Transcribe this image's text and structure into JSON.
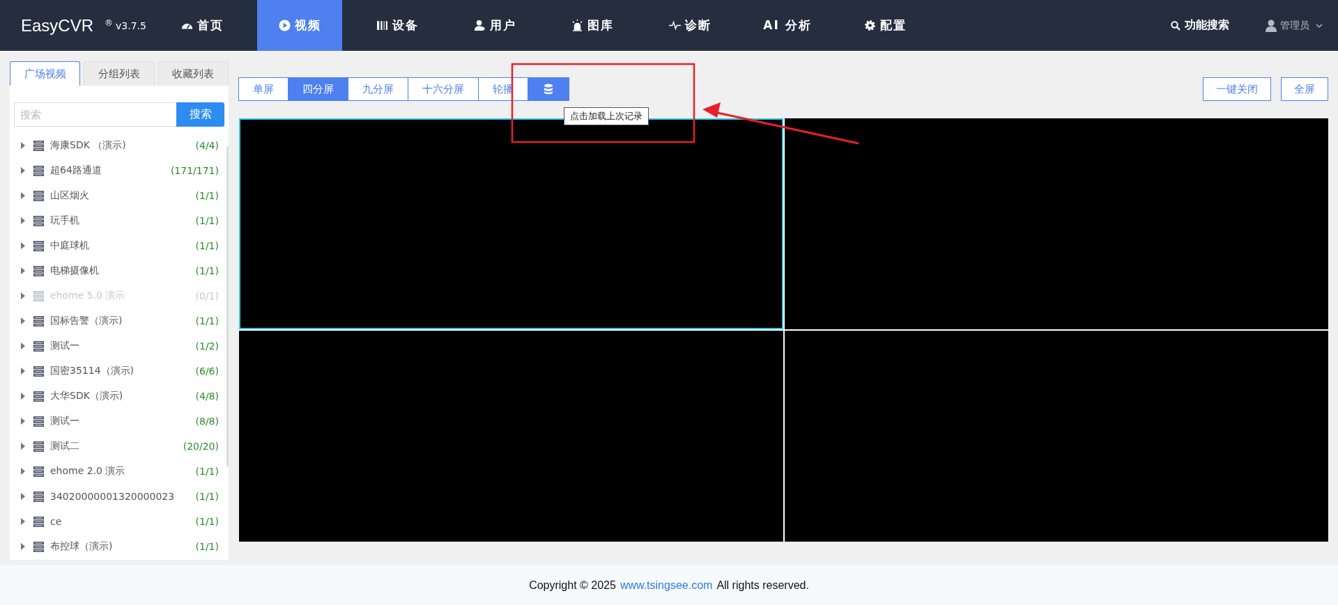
{
  "header": {
    "logo": "EasyCVR",
    "registered": "®",
    "version": "v3.7.5",
    "nav": [
      {
        "label": "首页",
        "kind": "gauge",
        "selected": false
      },
      {
        "label": "视频",
        "kind": "play",
        "selected": true
      },
      {
        "label": "设备",
        "kind": "bars",
        "selected": false
      },
      {
        "label": "用户",
        "kind": "user",
        "selected": false
      },
      {
        "label": "图库",
        "kind": "alarm",
        "selected": false
      },
      {
        "label": "诊断",
        "kind": "pulse",
        "selected": false
      },
      {
        "label": "AI 分析",
        "kind": "none",
        "selected": false
      },
      {
        "label": "配置",
        "kind": "gear",
        "selected": false
      }
    ],
    "search": "功能搜索",
    "user": "管理员"
  },
  "sidebar": {
    "tabs": [
      {
        "label": "广场视频",
        "selected": true
      },
      {
        "label": "分组列表",
        "selected": false
      },
      {
        "label": "收藏列表",
        "selected": false
      }
    ],
    "search": {
      "placeholder": "搜索",
      "button": "搜索"
    },
    "items": [
      {
        "name": "海康SDK （演示)",
        "count": "(4/4)",
        "disabled": false
      },
      {
        "name": "超64路通道",
        "count": "(171/171)",
        "disabled": false
      },
      {
        "name": "山区烟火",
        "count": "(1/1)",
        "disabled": false
      },
      {
        "name": "玩手机",
        "count": "(1/1)",
        "disabled": false
      },
      {
        "name": "中庭球机",
        "count": "(1/1)",
        "disabled": false
      },
      {
        "name": "电梯摄像机",
        "count": "(1/1)",
        "disabled": false
      },
      {
        "name": "ehome 5.0 演示",
        "count": "(0/1)",
        "disabled": true
      },
      {
        "name": "国标告警（演示)",
        "count": "(1/1)",
        "disabled": false
      },
      {
        "name": "测试一",
        "count": "(1/2)",
        "disabled": false
      },
      {
        "name": "国密35114（演示)",
        "count": "(6/6)",
        "disabled": false
      },
      {
        "name": "大华SDK（演示)",
        "count": "(4/8)",
        "disabled": false
      },
      {
        "name": "测试一",
        "count": "(8/8)",
        "disabled": false
      },
      {
        "name": "测试二",
        "count": "(20/20)",
        "disabled": false
      },
      {
        "name": "ehome 2.0 演示",
        "count": "(1/1)",
        "disabled": false
      },
      {
        "name": "34020000001320000023",
        "count": "(1/1)",
        "disabled": false
      },
      {
        "name": "ce",
        "count": "(1/1)",
        "disabled": false
      },
      {
        "name": "布控球（演示)",
        "count": "(1/1)",
        "disabled": false
      }
    ]
  },
  "toolbar": {
    "layouts": [
      {
        "label": "单屏",
        "selected": false
      },
      {
        "label": "四分屏",
        "selected": true
      },
      {
        "label": "九分屏",
        "selected": false
      },
      {
        "label": "十六分屏",
        "selected": false
      },
      {
        "label": "轮播",
        "selected": false
      }
    ],
    "tooltip": "点击加载上次记录",
    "actions": [
      "一键关闭",
      "全屏"
    ]
  },
  "panes": [
    {
      "selected": true
    },
    {
      "selected": false
    },
    {
      "selected": false
    },
    {
      "selected": false
    }
  ],
  "footer": {
    "before": "Copyright © 2025",
    "link": "www.tsingsee.com",
    "after": "All rights reserved."
  }
}
